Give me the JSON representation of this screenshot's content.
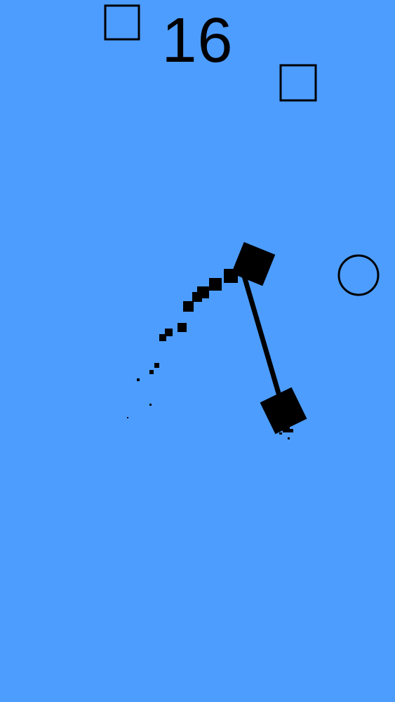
{
  "game": {
    "score": "16",
    "background_color": "#4d9dff",
    "foreground_color": "#000000"
  },
  "icons": {
    "outline_square": "hollow-square-target",
    "outline_circle": "hollow-circle-target",
    "player_block": "filled-square-block"
  }
}
